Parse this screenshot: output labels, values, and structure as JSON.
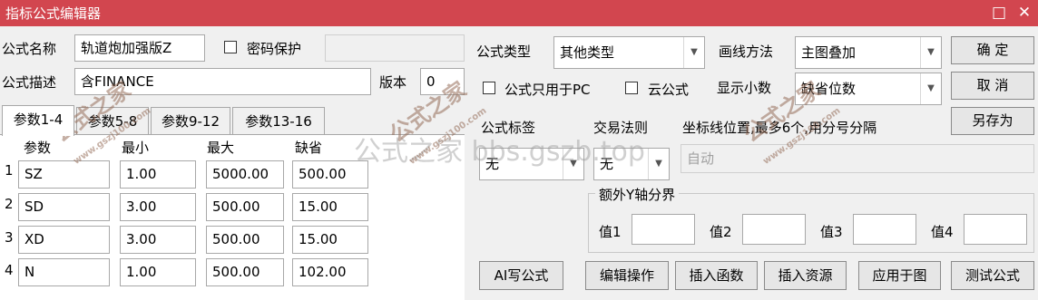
{
  "window": {
    "title": "指标公式编辑器",
    "minimize_glyph": "□",
    "close_glyph": "✕"
  },
  "form": {
    "name_label": "公式名称",
    "name_value": "轨道炮加强版Z",
    "password_label": "密码保护",
    "password_value": "",
    "desc_label": "公式描述",
    "desc_value": "含FINANCE",
    "version_label": "版本",
    "version_value": "0",
    "type_label": "公式类型",
    "type_value": "其他类型",
    "draw_label": "画线方法",
    "draw_value": "主图叠加",
    "pc_only_label": "公式只用于PC",
    "cloud_label": "云公式",
    "decimal_label": "显示小数",
    "decimal_value": "缺省位数",
    "formula_tag_label": "公式标签",
    "formula_tag_value": "无",
    "trade_rule_label": "交易法则",
    "trade_rule_value": "无",
    "coord_label": "坐标线位置,最多6个,用分号分隔",
    "coord_value": "自动",
    "yaxis_group_label": "额外Y轴分界",
    "yaxis_values": [
      {
        "label": "值1",
        "value": ""
      },
      {
        "label": "值2",
        "value": ""
      },
      {
        "label": "值3",
        "value": ""
      },
      {
        "label": "值4",
        "value": ""
      }
    ]
  },
  "tabs": [
    {
      "label": "参数1-4",
      "active": true
    },
    {
      "label": "参数5-8",
      "active": false
    },
    {
      "label": "参数9-12",
      "active": false
    },
    {
      "label": "参数13-16",
      "active": false
    }
  ],
  "params": {
    "headers": [
      "参数",
      "最小",
      "最大",
      "缺省"
    ],
    "rows": [
      {
        "index": "1",
        "name": "SZ",
        "min": "1.00",
        "max": "5000.00",
        "default": "500.00"
      },
      {
        "index": "2",
        "name": "SD",
        "min": "3.00",
        "max": "500.00",
        "default": "15.00"
      },
      {
        "index": "3",
        "name": "XD",
        "min": "3.00",
        "max": "500.00",
        "default": "15.00"
      },
      {
        "index": "4",
        "name": "N",
        "min": "1.00",
        "max": "500.00",
        "default": "102.00"
      }
    ]
  },
  "buttons": {
    "ok": "确 定",
    "cancel": "取 消",
    "save_as": "另存为",
    "ai_formula": "AI写公式",
    "edit_ops": "编辑操作",
    "insert_func": "插入函数",
    "insert_res": "插入资源",
    "apply_chart": "应用于图",
    "test_formula": "测试公式"
  },
  "watermarks": {
    "center_text": "公式之家 bbs.gszb.top",
    "stamp_text": "公式之家",
    "stamp_url": "www.gszj100.com"
  },
  "colors": {
    "titlebar": "#d2464f",
    "background": "#f0f0f0"
  },
  "icons": [
    "minimize-icon",
    "close-icon",
    "checkbox-icon",
    "dropdown-arrow-icon"
  ]
}
